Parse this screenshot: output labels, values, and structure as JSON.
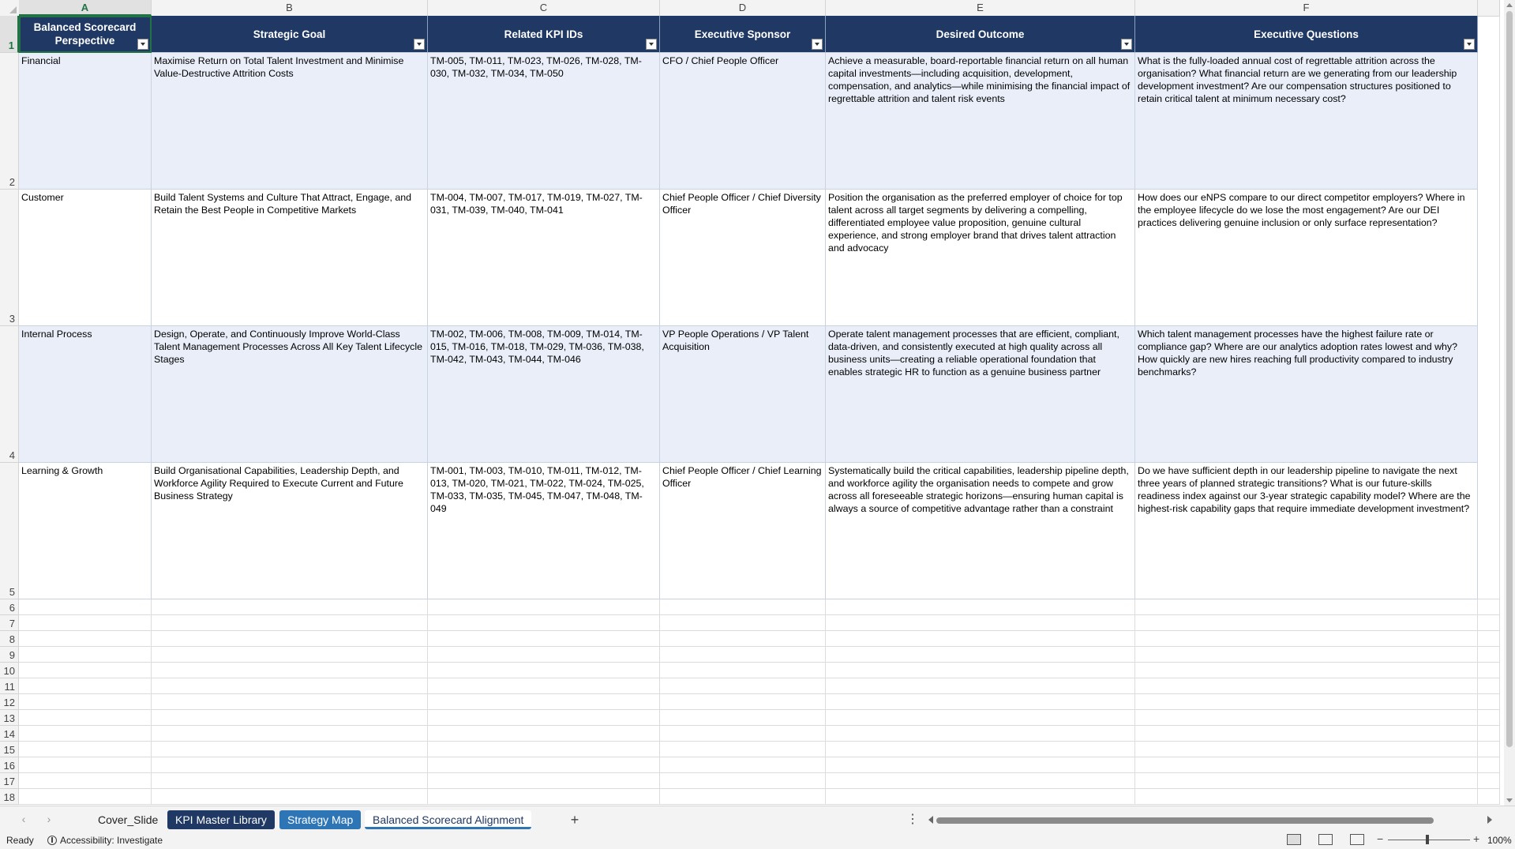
{
  "sheet": {
    "column_letters": [
      "A",
      "B",
      "C",
      "D",
      "E",
      "F"
    ],
    "headers": [
      "Balanced Scorecard Perspective",
      "Strategic Goal",
      "Related KPI IDs",
      "Executive Sponsor",
      "Desired Outcome",
      "Executive Questions"
    ],
    "rows": [
      {
        "perspective": "Financial",
        "goal": "Maximise Return on Total Talent Investment and Minimise Value-Destructive Attrition Costs",
        "kpis": "TM-005, TM-011, TM-023, TM-026, TM-028, TM-030, TM-032, TM-034, TM-050",
        "sponsor": "CFO / Chief People Officer",
        "outcome": "Achieve a measurable, board-reportable financial return on all human capital investments—including acquisition, development, compensation, and analytics—while minimising the financial impact of regrettable attrition and talent risk events",
        "questions": "What is the fully-loaded annual cost of regrettable attrition across the organisation? What financial return are we generating from our leadership development investment? Are our compensation structures positioned to retain critical talent at minimum necessary cost?"
      },
      {
        "perspective": "Customer",
        "goal": "Build Talent Systems and Culture That Attract, Engage, and Retain the Best People in Competitive Markets",
        "kpis": "TM-004, TM-007, TM-017, TM-019, TM-027, TM-031, TM-039, TM-040, TM-041",
        "sponsor": "Chief People Officer / Chief Diversity Officer",
        "outcome": "Position the organisation as the preferred employer of choice for top talent across all target segments by delivering a compelling, differentiated employee value proposition, genuine cultural experience, and strong employer brand that drives talent attraction and advocacy",
        "questions": "How does our eNPS compare to our direct competitor employers? Where in the employee lifecycle do we lose the most engagement? Are our DEI practices delivering genuine inclusion or only surface representation?"
      },
      {
        "perspective": "Internal Process",
        "goal": "Design, Operate, and Continuously Improve World-Class Talent Management Processes Across All Key Talent Lifecycle Stages",
        "kpis": "TM-002, TM-006, TM-008, TM-009, TM-014, TM-015, TM-016, TM-018, TM-029, TM-036, TM-038, TM-042, TM-043, TM-044, TM-046",
        "sponsor": "VP People Operations / VP Talent Acquisition",
        "outcome": "Operate talent management processes that are efficient, compliant, data-driven, and consistently executed at high quality across all business units—creating a reliable operational foundation that enables strategic HR to function as a genuine business partner",
        "questions": "Which talent management processes have the highest failure rate or compliance gap? Where are our analytics adoption rates lowest and why? How quickly are new hires reaching full productivity compared to industry benchmarks?"
      },
      {
        "perspective": "Learning & Growth",
        "goal": "Build Organisational Capabilities, Leadership Depth, and Workforce Agility Required to Execute Current and Future Business Strategy",
        "kpis": "TM-001, TM-003, TM-010, TM-011, TM-012, TM-013, TM-020, TM-021, TM-022, TM-024, TM-025, TM-033, TM-035, TM-045, TM-047, TM-048, TM-049",
        "sponsor": "Chief People Officer / Chief Learning Officer",
        "outcome": "Systematically build the critical capabilities, leadership pipeline depth, and workforce agility the organisation needs to compete and grow across all foreseeable strategic horizons—ensuring human capital is always a source of competitive advantage rather than a constraint",
        "questions": "Do we have sufficient depth in our leadership pipeline to navigate the next three years of planned strategic transitions? What is our future-skills readiness index against our 3-year strategic capability model? Where are the highest-risk capability gaps that require immediate development investment?"
      }
    ],
    "row_numbers": [
      "1",
      "2",
      "3",
      "4",
      "5",
      "6",
      "7",
      "8",
      "9",
      "10",
      "11",
      "12",
      "13",
      "14",
      "15",
      "16",
      "17",
      "18"
    ]
  },
  "tabs": [
    {
      "label": "Cover_Slide",
      "style": "plain"
    },
    {
      "label": "KPI Master Library",
      "style": "dark"
    },
    {
      "label": "Strategy Map",
      "style": "blue"
    },
    {
      "label": "Balanced Scorecard Alignment",
      "style": "active"
    }
  ],
  "status": {
    "ready": "Ready",
    "accessibility": "Accessibility: Investigate",
    "zoom": "100%"
  }
}
